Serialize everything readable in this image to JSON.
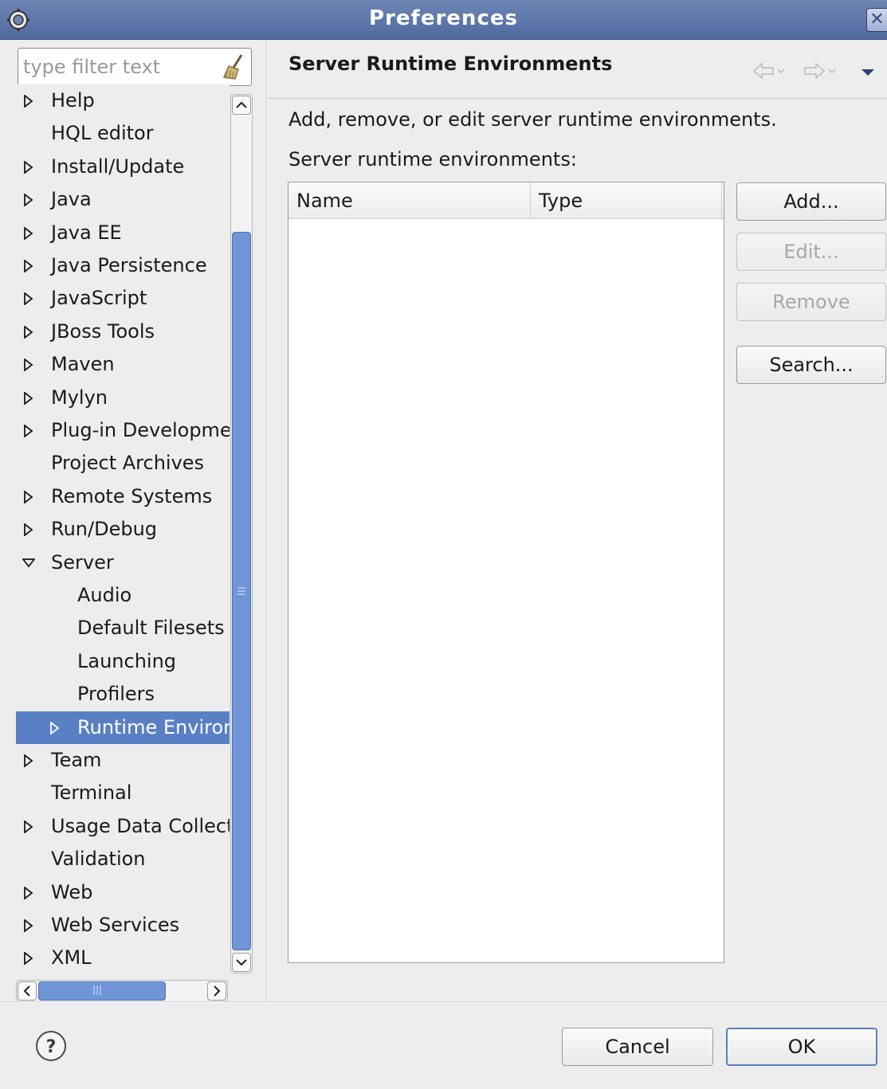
{
  "window": {
    "title": "Preferences",
    "app_icon": "eclipse-gear-icon",
    "close_icon": "close-icon",
    "close_glyph": "✕"
  },
  "filter": {
    "placeholder": "type filter text",
    "value": "",
    "clear_icon": "broom-clear-icon"
  },
  "tree": {
    "items": [
      {
        "label": "Help",
        "expander": "collapsed",
        "level": 0
      },
      {
        "label": "HQL editor",
        "expander": "none",
        "level": 0
      },
      {
        "label": "Install/Update",
        "expander": "collapsed",
        "level": 0
      },
      {
        "label": "Java",
        "expander": "collapsed",
        "level": 0
      },
      {
        "label": "Java EE",
        "expander": "collapsed",
        "level": 0
      },
      {
        "label": "Java Persistence",
        "expander": "collapsed",
        "level": 0
      },
      {
        "label": "JavaScript",
        "expander": "collapsed",
        "level": 0
      },
      {
        "label": "JBoss Tools",
        "expander": "collapsed",
        "level": 0
      },
      {
        "label": "Maven",
        "expander": "collapsed",
        "level": 0
      },
      {
        "label": "Mylyn",
        "expander": "collapsed",
        "level": 0
      },
      {
        "label": "Plug-in Development",
        "expander": "collapsed",
        "level": 0
      },
      {
        "label": "Project Archives",
        "expander": "none",
        "level": 0
      },
      {
        "label": "Remote Systems",
        "expander": "collapsed",
        "level": 0
      },
      {
        "label": "Run/Debug",
        "expander": "collapsed",
        "level": 0
      },
      {
        "label": "Server",
        "expander": "expanded",
        "level": 0
      },
      {
        "label": "Audio",
        "expander": "none",
        "level": 1
      },
      {
        "label": "Default Filesets",
        "expander": "none",
        "level": 1
      },
      {
        "label": "Launching",
        "expander": "none",
        "level": 1
      },
      {
        "label": "Profilers",
        "expander": "none",
        "level": 1
      },
      {
        "label": "Runtime Environments",
        "expander": "collapsed",
        "level": 1,
        "selected": true
      },
      {
        "label": "Team",
        "expander": "collapsed",
        "level": 0
      },
      {
        "label": "Terminal",
        "expander": "none",
        "level": 0
      },
      {
        "label": "Usage Data Collector",
        "expander": "collapsed",
        "level": 0
      },
      {
        "label": "Validation",
        "expander": "none",
        "level": 0
      },
      {
        "label": "Web",
        "expander": "collapsed",
        "level": 0
      },
      {
        "label": "Web Services",
        "expander": "collapsed",
        "level": 0
      },
      {
        "label": "XML",
        "expander": "collapsed",
        "level": 0
      }
    ],
    "selection_color": "#5a7fc4"
  },
  "page": {
    "title": "Server Runtime Environments",
    "description": "Add, remove, or edit server runtime environments.",
    "list_label": "Server runtime environments:",
    "nav_icons": [
      "back-arrow-icon",
      "forward-arrow-icon",
      "view-menu-icon"
    ],
    "table": {
      "columns": [
        "Name",
        "Type"
      ],
      "rows": []
    },
    "buttons": {
      "add": {
        "label": "Add...",
        "enabled": true
      },
      "edit": {
        "label": "Edit...",
        "enabled": false
      },
      "remove": {
        "label": "Remove",
        "enabled": false
      },
      "search": {
        "label": "Search...",
        "enabled": true
      }
    }
  },
  "footer": {
    "help_icon": "help-question-icon",
    "cancel_label": "Cancel",
    "ok_label": "OK"
  },
  "colors": {
    "titlebar": "#5b74a8",
    "scroll_thumb": "#6f95d6",
    "background": "#ededed"
  }
}
